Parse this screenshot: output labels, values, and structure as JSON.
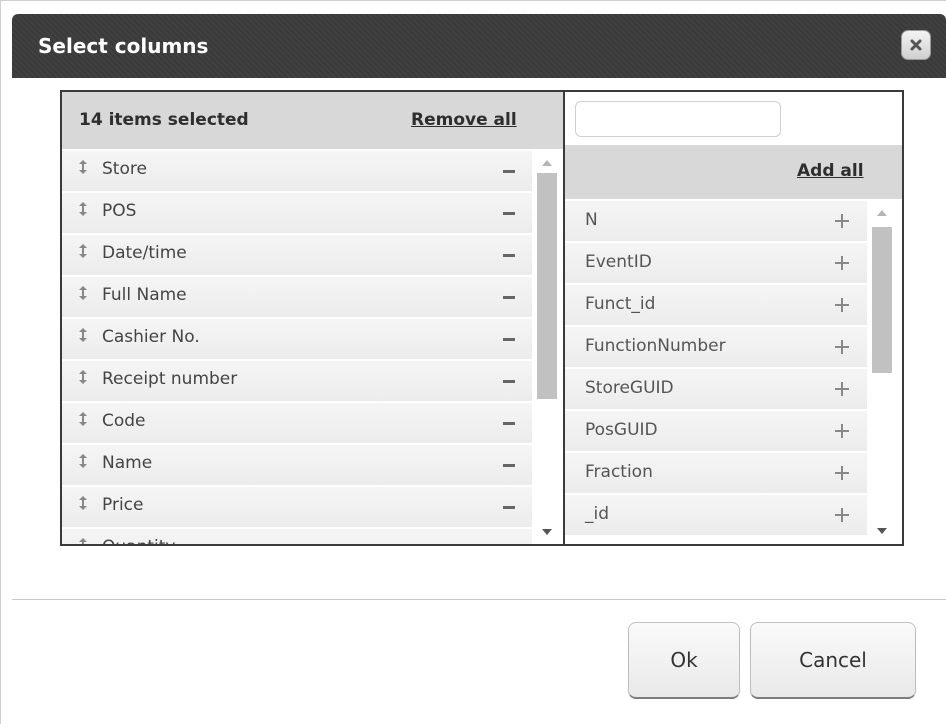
{
  "dialog": {
    "title": "Select columns",
    "close_icon": "close-icon"
  },
  "selected": {
    "count_label": "14 items selected",
    "remove_all_label": "Remove all",
    "items": [
      {
        "label": "Store"
      },
      {
        "label": "POS"
      },
      {
        "label": "Date/time"
      },
      {
        "label": "Full Name"
      },
      {
        "label": "Cashier No."
      },
      {
        "label": "Receipt number"
      },
      {
        "label": "Code"
      },
      {
        "label": "Name"
      },
      {
        "label": "Price"
      },
      {
        "label": "Quantity"
      }
    ]
  },
  "available": {
    "search_value": "",
    "add_all_label": "Add all",
    "items": [
      {
        "label": "N"
      },
      {
        "label": "EventID"
      },
      {
        "label": "Funct_id"
      },
      {
        "label": "FunctionNumber"
      },
      {
        "label": "StoreGUID"
      },
      {
        "label": "PosGUID"
      },
      {
        "label": "Fraction"
      },
      {
        "label": "_id"
      }
    ]
  },
  "buttons": {
    "ok_label": "Ok",
    "cancel_label": "Cancel"
  },
  "colors": {
    "titlebar": "#3c3c3c",
    "header": "#d8d8d8",
    "item": "#efefef"
  }
}
